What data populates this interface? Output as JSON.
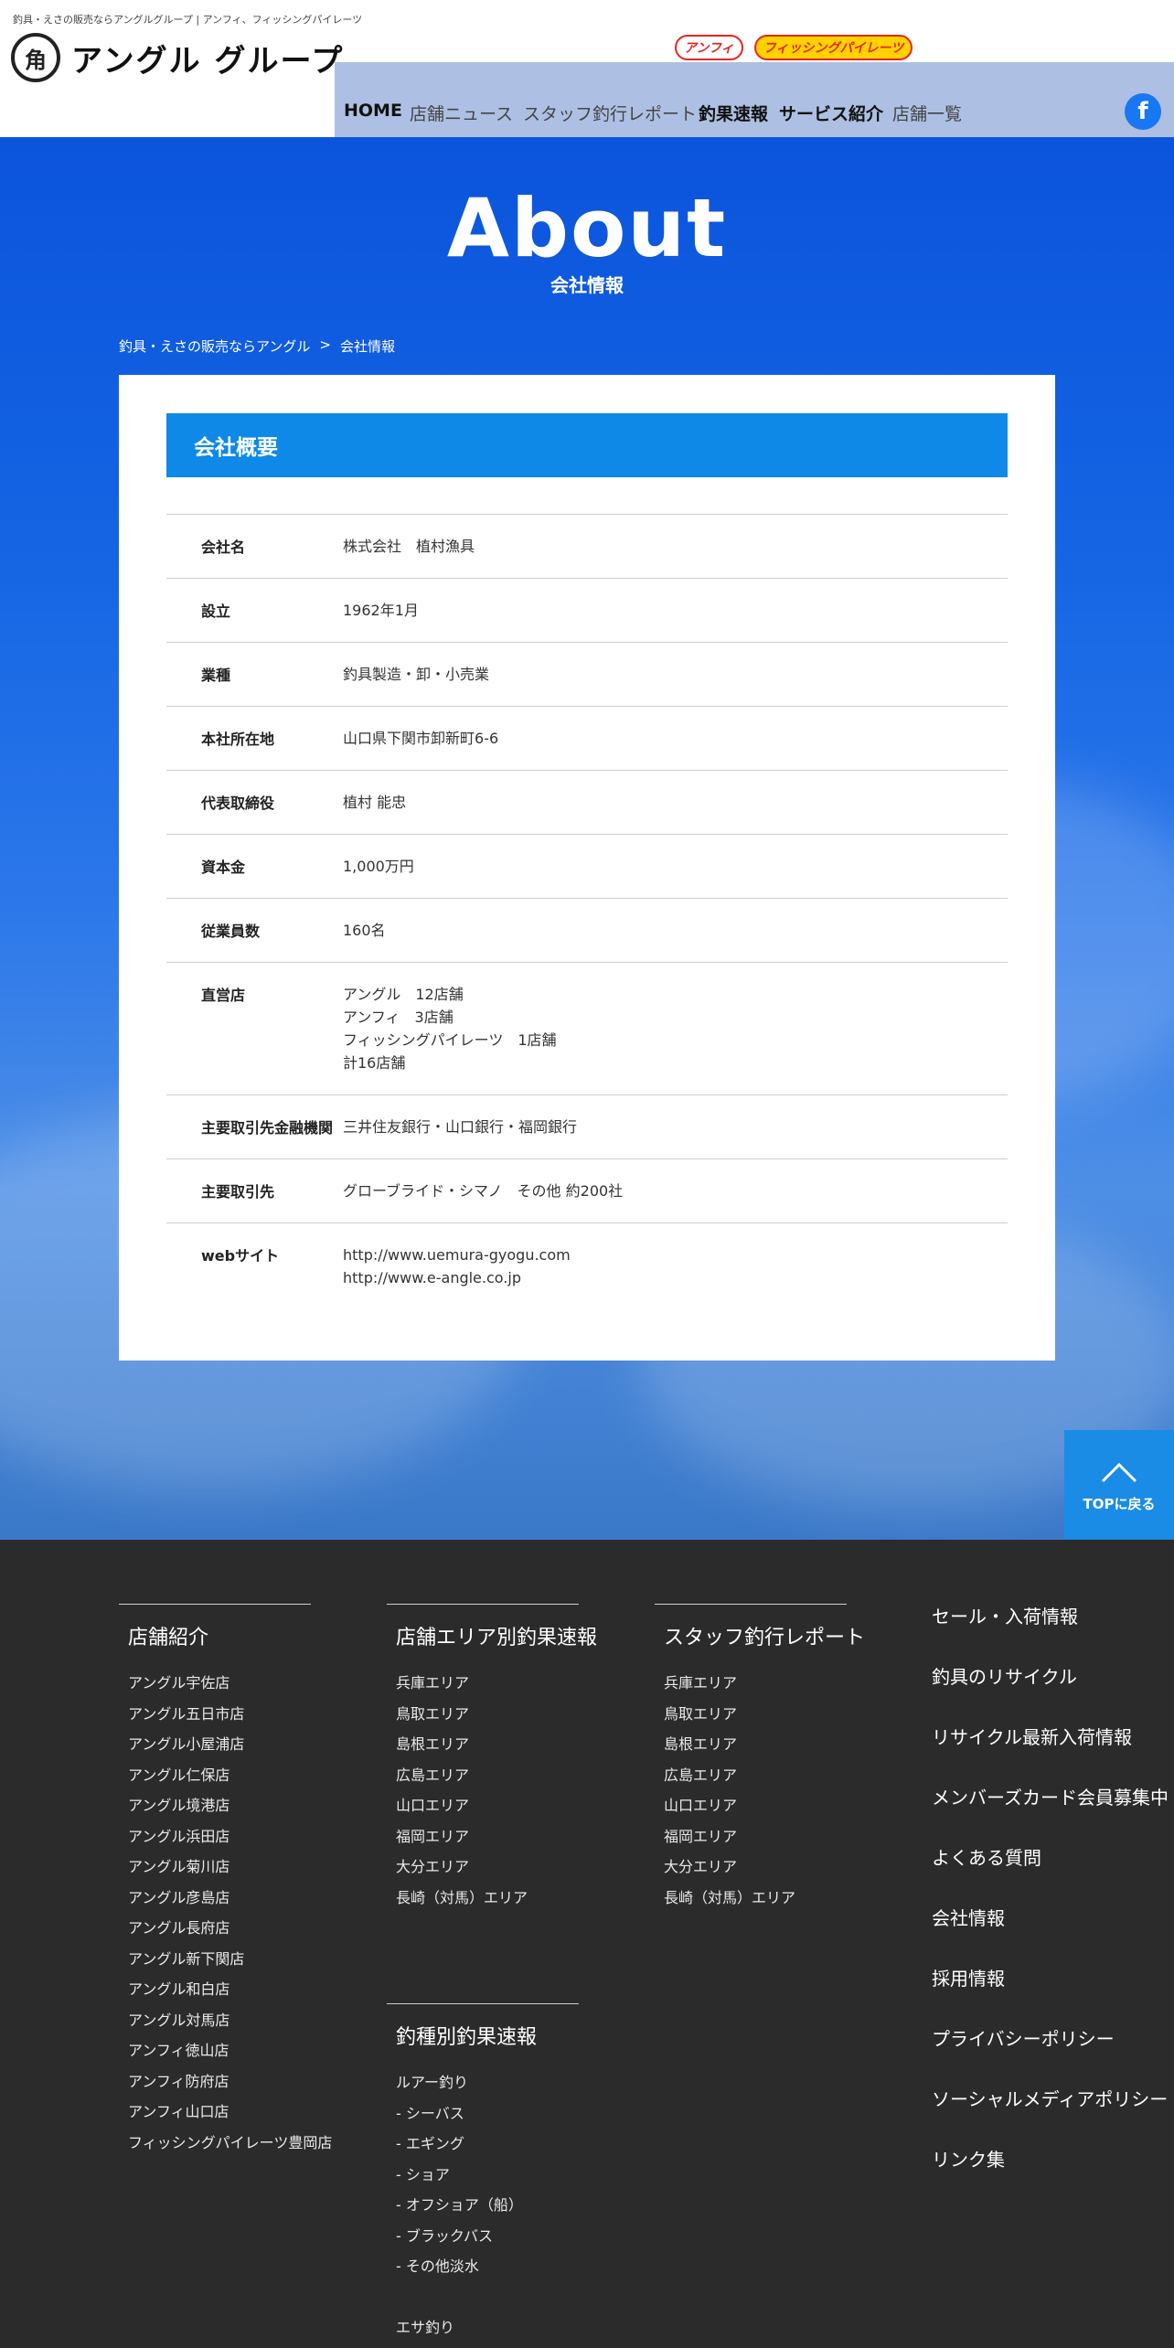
{
  "header": {
    "tagline": "釣具・えさの販売ならアングルグループ | アンフィ、フィッシングパイレーツ",
    "logo_text": "アングル グループ",
    "logo_mark": "角",
    "brand_logos": [
      "アンフィ",
      "フィッシングパイレーツ"
    ],
    "nav": [
      {
        "label": "HOME",
        "style": "dark"
      },
      {
        "label": "店舗ニュース",
        "style": "light"
      },
      {
        "label": "スタッフ釣行レポート",
        "style": "light"
      },
      {
        "label": "釣果速報",
        "style": "dark"
      },
      {
        "label": "サービス紹介",
        "style": "dark"
      },
      {
        "label": "店舗一覧",
        "style": "light"
      }
    ],
    "facebook_glyph": "f"
  },
  "hero": {
    "title": "About",
    "subtitle": "会社情報",
    "breadcrumb": [
      "釣具・えさの販売ならアングル",
      ">",
      "会社情報"
    ]
  },
  "company": {
    "heading": "会社概要",
    "rows": [
      {
        "label": "会社名",
        "value": [
          "株式会社　植村漁具"
        ]
      },
      {
        "label": "設立",
        "value": [
          "1962年1月"
        ]
      },
      {
        "label": "業種",
        "value": [
          "釣具製造・卸・小売業"
        ]
      },
      {
        "label": "本社所在地",
        "value": [
          "山口県下関市卸新町6-6"
        ]
      },
      {
        "label": "代表取締役",
        "value": [
          "植村 能忠"
        ]
      },
      {
        "label": "資本金",
        "value": [
          "1,000万円"
        ]
      },
      {
        "label": "従業員数",
        "value": [
          "160名"
        ]
      },
      {
        "label": "直営店",
        "value": [
          "アングル　12店舗",
          "アンフィ　3店舗",
          "フィッシングパイレーツ　1店舗",
          "計16店舗"
        ]
      },
      {
        "label": "主要取引先金融機関",
        "value": [
          "三井住友銀行・山口銀行・福岡銀行"
        ]
      },
      {
        "label": "主要取引先",
        "value": [
          "グローブライド・シマノ　その他 約200社"
        ]
      },
      {
        "label": "webサイト",
        "value": [
          "http://www.uemura-gyogu.com",
          "http://www.e-angle.co.jp"
        ]
      }
    ]
  },
  "top_button": {
    "label": "TOPに戻る"
  },
  "footer": {
    "stores": {
      "heading": "店舗紹介",
      "items": [
        "アングル宇佐店",
        "アングル五日市店",
        "アングル小屋浦店",
        "アングル仁保店",
        "アングル境港店",
        "アングル浜田店",
        "アングル菊川店",
        "アングル彦島店",
        "アングル長府店",
        "アングル新下関店",
        "アングル和白店",
        "アングル対馬店",
        "アンフィ徳山店",
        "アンフィ防府店",
        "アンフィ山口店",
        "フィッシングパイレーツ豊岡店"
      ]
    },
    "area_reports": {
      "heading": "店舗エリア別釣果速報",
      "items": [
        "兵庫エリア",
        "鳥取エリア",
        "島根エリア",
        "広島エリア",
        "山口エリア",
        "福岡エリア",
        "大分エリア",
        "長崎（対馬）エリア"
      ]
    },
    "species_reports": {
      "heading": "釣種別釣果速報",
      "items": [
        "ルアー釣り",
        "- シーバス",
        "- エギング",
        "- ショア",
        "- オフショア（船）",
        "- ブラックバス",
        "- その他淡水",
        "",
        "エサ釣り"
      ]
    },
    "staff_reports": {
      "heading": "スタッフ釣行レポート",
      "items": [
        "兵庫エリア",
        "鳥取エリア",
        "島根エリア",
        "広島エリア",
        "山口エリア",
        "福岡エリア",
        "大分エリア",
        "長崎（対馬）エリア"
      ]
    },
    "links": [
      "セール・入荷情報",
      "釣具のリサイクル",
      "リサイクル最新入荷情報",
      "メンバーズカード会員募集中",
      "よくある質問",
      "会社情報",
      "採用情報",
      "プライバシーポリシー",
      "ソーシャルメディアポリシー",
      "リンク集"
    ]
  }
}
